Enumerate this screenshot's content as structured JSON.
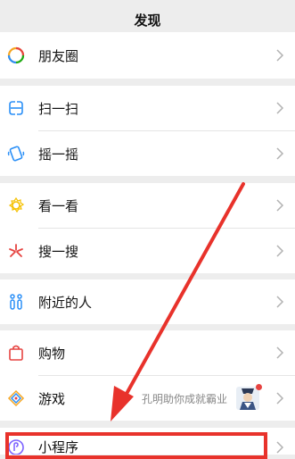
{
  "header": {
    "title": "发现"
  },
  "rows": [
    {
      "label": "朋友圈",
      "icon": "moments-icon"
    },
    {
      "label": "扫一扫",
      "icon": "scan-icon"
    },
    {
      "label": "摇一摇",
      "icon": "shake-icon"
    },
    {
      "label": "看一看",
      "icon": "top-stories-icon"
    },
    {
      "label": "搜一搜",
      "icon": "search-icon"
    },
    {
      "label": "附近的人",
      "icon": "people-nearby-icon"
    },
    {
      "label": "购物",
      "icon": "shopping-bag-icon"
    },
    {
      "label": "游戏",
      "icon": "game-icon",
      "extra_text": "孔明助你成就霸业"
    },
    {
      "label": "小程序",
      "icon": "mini-program-icon"
    }
  ],
  "colors": {
    "accent_red": "#e8322b",
    "background": "#ededed"
  }
}
